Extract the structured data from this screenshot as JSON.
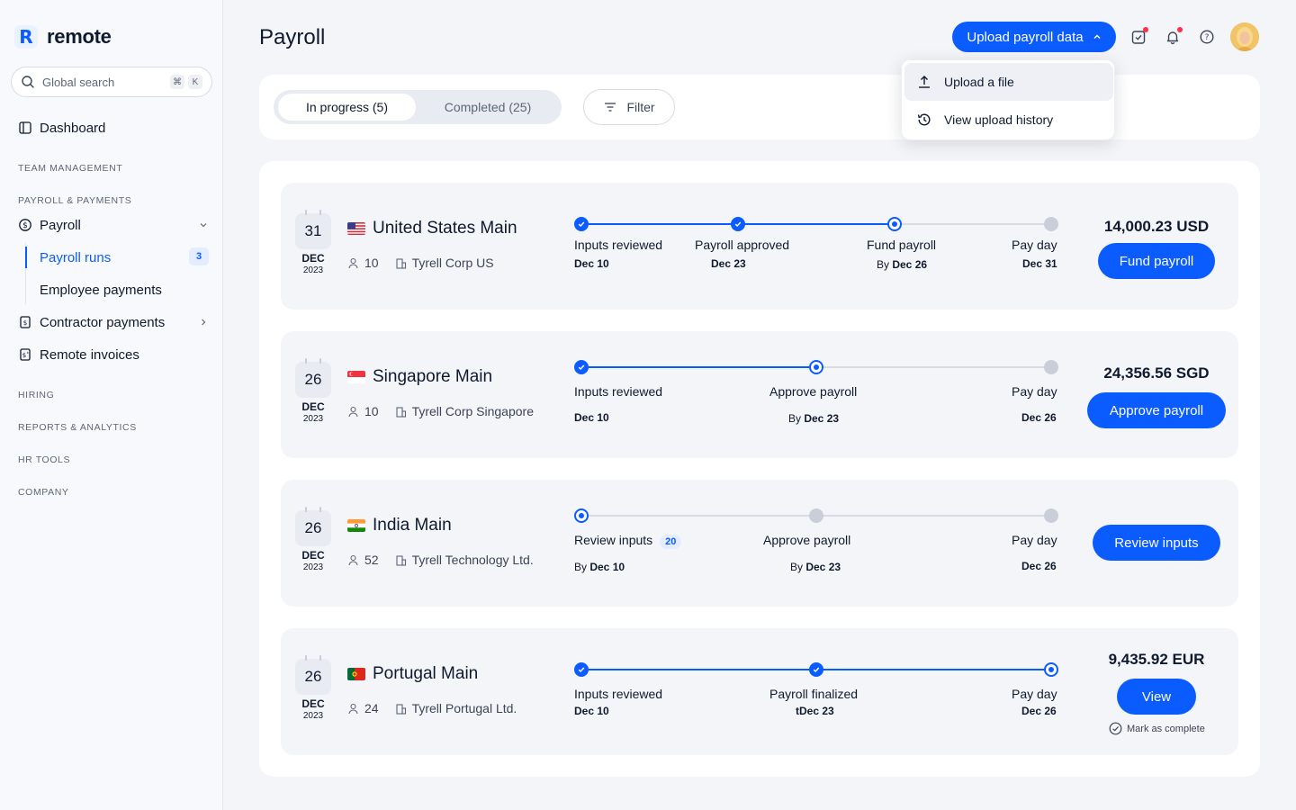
{
  "app": {
    "name": "remote"
  },
  "sidebar": {
    "search_placeholder": "Global search",
    "kbd": [
      "⌘",
      "K"
    ],
    "dashboard": "Dashboard",
    "sections": [
      "TEAM MANAGEMENT",
      "PAYROLL & PAYMENTS",
      "HIRING",
      "REPORTS & ANALYTICS",
      "HR TOOLS",
      "COMPANY"
    ],
    "payroll": "Payroll",
    "payroll_runs": "Payroll runs",
    "payroll_runs_count": "3",
    "employee_payments": "Employee payments",
    "contractor_payments": "Contractor payments",
    "remote_invoices": "Remote invoices"
  },
  "header": {
    "title": "Payroll",
    "upload_button": "Upload payroll data"
  },
  "dropdown": {
    "items": [
      "Upload a file",
      "View upload history"
    ]
  },
  "tabs": {
    "in_progress": "In progress (5)",
    "completed": "Completed (25)",
    "filter": "Filter"
  },
  "colors": {
    "accent": "#0b5cff",
    "done_track": "#0b5cff",
    "todo_node": "#c9ced9"
  },
  "runs": [
    {
      "day": "31",
      "month": "DEC",
      "year": "2023",
      "name": "United States Main",
      "flag": "us",
      "people": "10",
      "entity": "Tyrell Corp US",
      "steps": [
        {
          "label": "Inputs reviewed",
          "date": "Dec 10",
          "prefix": "",
          "state": "done"
        },
        {
          "label": "Payroll approved",
          "date": "Dec 23",
          "prefix": "",
          "state": "done"
        },
        {
          "label": "Fund payroll",
          "date": "Dec 26",
          "prefix": "By ",
          "state": "current"
        },
        {
          "label": "Pay day",
          "date": "Dec 31",
          "prefix": "",
          "state": "todo"
        }
      ],
      "amount": "14,000.23 USD",
      "action": "Fund payroll"
    },
    {
      "day": "26",
      "month": "DEC",
      "year": "2023",
      "name": "Singapore Main",
      "flag": "sg",
      "people": "10",
      "entity": "Tyrell Corp Singapore",
      "steps": [
        {
          "label": "Inputs reviewed",
          "date": "Dec 10",
          "prefix": "",
          "state": "done"
        },
        {
          "label": "Approve payroll",
          "date": "Dec 23",
          "prefix": "By ",
          "state": "current"
        },
        {
          "label": "Pay day",
          "date": "Dec 26",
          "prefix": "",
          "state": "todo"
        }
      ],
      "amount": "24,356.56 SGD",
      "action": "Approve payroll"
    },
    {
      "day": "26",
      "month": "DEC",
      "year": "2023",
      "name": "India Main",
      "flag": "in",
      "people": "52",
      "entity": "Tyrell Technology Ltd.",
      "steps": [
        {
          "label": "Review inputs",
          "date": "Dec 10",
          "prefix": "By ",
          "state": "current",
          "badge": "20"
        },
        {
          "label": "Approve payroll",
          "date": "Dec 23",
          "prefix": "By ",
          "state": "todo"
        },
        {
          "label": "Pay day",
          "date": "Dec 26",
          "prefix": "",
          "state": "todo"
        }
      ],
      "amount": "",
      "action": "Review inputs"
    },
    {
      "day": "26",
      "month": "DEC",
      "year": "2023",
      "name": "Portugal Main",
      "flag": "pt",
      "people": "24",
      "entity": "Tyrell Portugal Ltd.",
      "steps": [
        {
          "label": "Inputs reviewed",
          "date": "Dec 10",
          "prefix": "",
          "state": "done"
        },
        {
          "label": "Payroll finalized",
          "date": "tDec 23",
          "prefix": "",
          "state": "done"
        },
        {
          "label": "Pay day",
          "date": "Dec 26",
          "prefix": "",
          "state": "current"
        }
      ],
      "amount": "9,435.92 EUR",
      "action": "View",
      "secondary": "Mark as complete"
    }
  ]
}
